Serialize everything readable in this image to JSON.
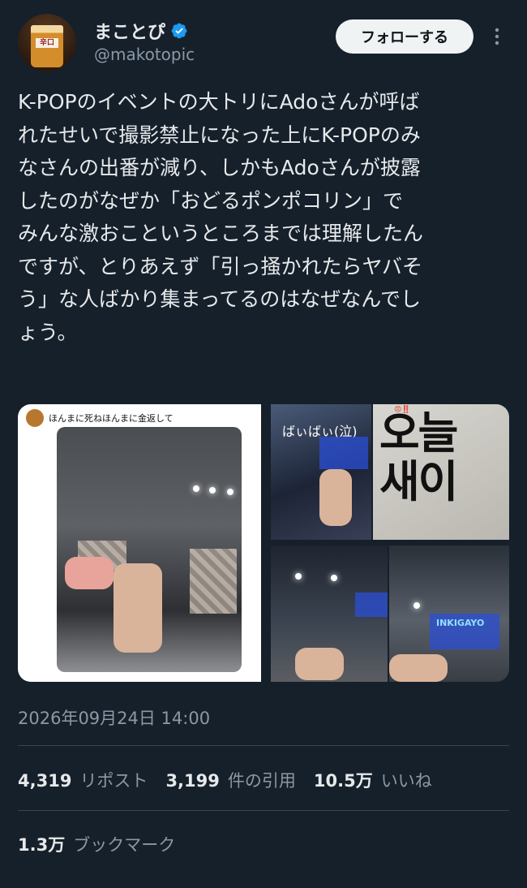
{
  "author": {
    "display_name": "まことぴ",
    "handle": "@makotopic",
    "avatar_label": "辛口"
  },
  "follow_button_label": "フォローする",
  "tweet": {
    "lines": [
      "K-POPのイベントの大トリにAdoさんが呼ば",
      "れたせいで撮影禁止になった上にK-POPのみ",
      "なさんの出番が減り、しかもAdoさんが披露",
      "したのがなぜか「おどるポンポコリン」で",
      "みんな激おこというところまでは理解したん",
      "ですが、とりあえず「引っ掻かれたらヤバそ",
      "う」な人ばかり集まってるのはなぜなんでし",
      "ょう。"
    ]
  },
  "media": {
    "image1_caption": "ほんまに死ねほんまに金返して",
    "image2_caption": "ばぃばぃ(泣)",
    "image3_text": "오늘\n새이",
    "image3_tag": "😡‼️",
    "image5_sign": "INKIGAYO"
  },
  "timestamp": "2026年09月24日 14:00",
  "stats": {
    "reposts_count": "4,319",
    "reposts_label": "リポスト",
    "quotes_count": "3,199",
    "quotes_label": "件の引用",
    "likes_count": "10.5万",
    "likes_label": "いいね",
    "bookmarks_count": "1.3万",
    "bookmarks_label": "ブックマーク"
  },
  "colors": {
    "background": "#15202b",
    "verified": "#1d9bf0",
    "secondary_text": "#8b98a5",
    "divider": "#38444d"
  }
}
